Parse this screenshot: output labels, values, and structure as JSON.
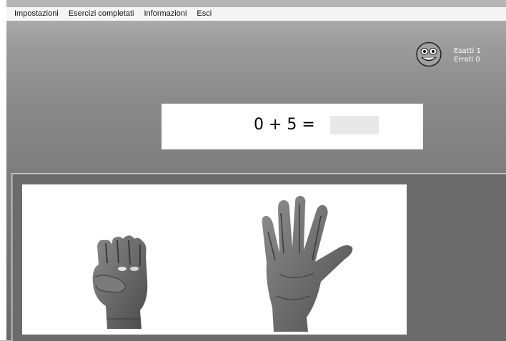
{
  "menu": {
    "items": [
      "Impostazioni",
      "Esercizi completati",
      "Informazioni",
      "Esci"
    ]
  },
  "status": {
    "face_icon": "smiley-face-icon",
    "correct_label": "Esatti 1",
    "wrong_label": "Errati 0"
  },
  "exercise": {
    "equation": "0 + 5 =",
    "answer_value": ""
  },
  "hands": {
    "left": {
      "icon": "closed-fist-hand",
      "fingers": 0
    },
    "right": {
      "icon": "open-hand",
      "fingers": 5
    }
  }
}
